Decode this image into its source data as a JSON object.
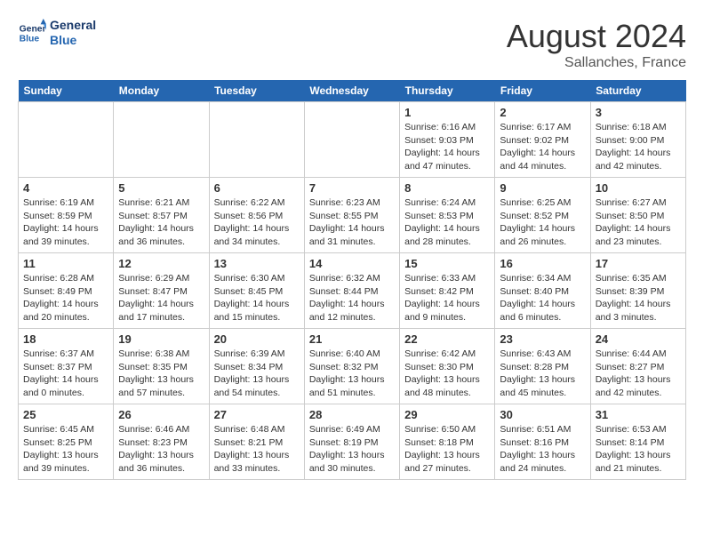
{
  "header": {
    "logo_line1": "General",
    "logo_line2": "Blue",
    "title": "August 2024",
    "subtitle": "Sallanches, France"
  },
  "days_of_week": [
    "Sunday",
    "Monday",
    "Tuesday",
    "Wednesday",
    "Thursday",
    "Friday",
    "Saturday"
  ],
  "weeks": [
    [
      {
        "date": "",
        "text": ""
      },
      {
        "date": "",
        "text": ""
      },
      {
        "date": "",
        "text": ""
      },
      {
        "date": "",
        "text": ""
      },
      {
        "date": "1",
        "text": "Sunrise: 6:16 AM\nSunset: 9:03 PM\nDaylight: 14 hours\nand 47 minutes."
      },
      {
        "date": "2",
        "text": "Sunrise: 6:17 AM\nSunset: 9:02 PM\nDaylight: 14 hours\nand 44 minutes."
      },
      {
        "date": "3",
        "text": "Sunrise: 6:18 AM\nSunset: 9:00 PM\nDaylight: 14 hours\nand 42 minutes."
      }
    ],
    [
      {
        "date": "4",
        "text": "Sunrise: 6:19 AM\nSunset: 8:59 PM\nDaylight: 14 hours\nand 39 minutes."
      },
      {
        "date": "5",
        "text": "Sunrise: 6:21 AM\nSunset: 8:57 PM\nDaylight: 14 hours\nand 36 minutes."
      },
      {
        "date": "6",
        "text": "Sunrise: 6:22 AM\nSunset: 8:56 PM\nDaylight: 14 hours\nand 34 minutes."
      },
      {
        "date": "7",
        "text": "Sunrise: 6:23 AM\nSunset: 8:55 PM\nDaylight: 14 hours\nand 31 minutes."
      },
      {
        "date": "8",
        "text": "Sunrise: 6:24 AM\nSunset: 8:53 PM\nDaylight: 14 hours\nand 28 minutes."
      },
      {
        "date": "9",
        "text": "Sunrise: 6:25 AM\nSunset: 8:52 PM\nDaylight: 14 hours\nand 26 minutes."
      },
      {
        "date": "10",
        "text": "Sunrise: 6:27 AM\nSunset: 8:50 PM\nDaylight: 14 hours\nand 23 minutes."
      }
    ],
    [
      {
        "date": "11",
        "text": "Sunrise: 6:28 AM\nSunset: 8:49 PM\nDaylight: 14 hours\nand 20 minutes."
      },
      {
        "date": "12",
        "text": "Sunrise: 6:29 AM\nSunset: 8:47 PM\nDaylight: 14 hours\nand 17 minutes."
      },
      {
        "date": "13",
        "text": "Sunrise: 6:30 AM\nSunset: 8:45 PM\nDaylight: 14 hours\nand 15 minutes."
      },
      {
        "date": "14",
        "text": "Sunrise: 6:32 AM\nSunset: 8:44 PM\nDaylight: 14 hours\nand 12 minutes."
      },
      {
        "date": "15",
        "text": "Sunrise: 6:33 AM\nSunset: 8:42 PM\nDaylight: 14 hours\nand 9 minutes."
      },
      {
        "date": "16",
        "text": "Sunrise: 6:34 AM\nSunset: 8:40 PM\nDaylight: 14 hours\nand 6 minutes."
      },
      {
        "date": "17",
        "text": "Sunrise: 6:35 AM\nSunset: 8:39 PM\nDaylight: 14 hours\nand 3 minutes."
      }
    ],
    [
      {
        "date": "18",
        "text": "Sunrise: 6:37 AM\nSunset: 8:37 PM\nDaylight: 14 hours\nand 0 minutes."
      },
      {
        "date": "19",
        "text": "Sunrise: 6:38 AM\nSunset: 8:35 PM\nDaylight: 13 hours\nand 57 minutes."
      },
      {
        "date": "20",
        "text": "Sunrise: 6:39 AM\nSunset: 8:34 PM\nDaylight: 13 hours\nand 54 minutes."
      },
      {
        "date": "21",
        "text": "Sunrise: 6:40 AM\nSunset: 8:32 PM\nDaylight: 13 hours\nand 51 minutes."
      },
      {
        "date": "22",
        "text": "Sunrise: 6:42 AM\nSunset: 8:30 PM\nDaylight: 13 hours\nand 48 minutes."
      },
      {
        "date": "23",
        "text": "Sunrise: 6:43 AM\nSunset: 8:28 PM\nDaylight: 13 hours\nand 45 minutes."
      },
      {
        "date": "24",
        "text": "Sunrise: 6:44 AM\nSunset: 8:27 PM\nDaylight: 13 hours\nand 42 minutes."
      }
    ],
    [
      {
        "date": "25",
        "text": "Sunrise: 6:45 AM\nSunset: 8:25 PM\nDaylight: 13 hours\nand 39 minutes."
      },
      {
        "date": "26",
        "text": "Sunrise: 6:46 AM\nSunset: 8:23 PM\nDaylight: 13 hours\nand 36 minutes."
      },
      {
        "date": "27",
        "text": "Sunrise: 6:48 AM\nSunset: 8:21 PM\nDaylight: 13 hours\nand 33 minutes."
      },
      {
        "date": "28",
        "text": "Sunrise: 6:49 AM\nSunset: 8:19 PM\nDaylight: 13 hours\nand 30 minutes."
      },
      {
        "date": "29",
        "text": "Sunrise: 6:50 AM\nSunset: 8:18 PM\nDaylight: 13 hours\nand 27 minutes."
      },
      {
        "date": "30",
        "text": "Sunrise: 6:51 AM\nSunset: 8:16 PM\nDaylight: 13 hours\nand 24 minutes."
      },
      {
        "date": "31",
        "text": "Sunrise: 6:53 AM\nSunset: 8:14 PM\nDaylight: 13 hours\nand 21 minutes."
      }
    ]
  ]
}
